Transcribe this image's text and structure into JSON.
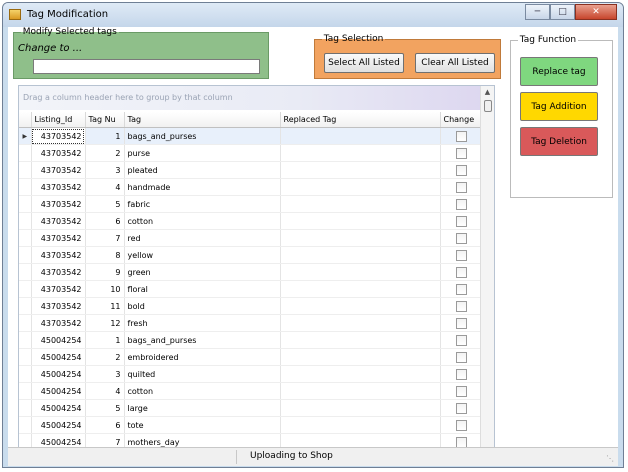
{
  "window": {
    "title": "Tag Modification",
    "minimize_icon": "minimize-icon",
    "maximize_icon": "maximize-icon",
    "close_icon": "close-icon"
  },
  "modify_group": {
    "legend": "Modify Selected tags",
    "change_label": "Change to ...",
    "change_value": ""
  },
  "tag_selection": {
    "legend": "Tag Selection",
    "select_all": "Select All Listed",
    "clear_all": "Clear All Listed"
  },
  "tag_function": {
    "legend": "Tag Function",
    "replace": "Replace tag",
    "addition": "Tag Addition",
    "deletion": "Tag Deletion",
    "colors": {
      "replace": "#7fd77f",
      "addition": "#ffd800",
      "deletion": "#d9595a"
    }
  },
  "grid": {
    "group_hint": "Drag a column header here to group by that column",
    "columns": [
      "Listing_Id",
      "Tag Nu",
      "Tag",
      "Replaced Tag",
      "Change"
    ],
    "rows": [
      {
        "id": "43703542",
        "num": "1",
        "tag": "bags_and_purses",
        "replaced": ""
      },
      {
        "id": "43703542",
        "num": "2",
        "tag": "purse",
        "replaced": ""
      },
      {
        "id": "43703542",
        "num": "3",
        "tag": "pleated",
        "replaced": ""
      },
      {
        "id": "43703542",
        "num": "4",
        "tag": "handmade",
        "replaced": ""
      },
      {
        "id": "43703542",
        "num": "5",
        "tag": "fabric",
        "replaced": ""
      },
      {
        "id": "43703542",
        "num": "6",
        "tag": "cotton",
        "replaced": ""
      },
      {
        "id": "43703542",
        "num": "7",
        "tag": "red",
        "replaced": ""
      },
      {
        "id": "43703542",
        "num": "8",
        "tag": "yellow",
        "replaced": ""
      },
      {
        "id": "43703542",
        "num": "9",
        "tag": "green",
        "replaced": ""
      },
      {
        "id": "43703542",
        "num": "10",
        "tag": "floral",
        "replaced": ""
      },
      {
        "id": "43703542",
        "num": "11",
        "tag": "bold",
        "replaced": ""
      },
      {
        "id": "43703542",
        "num": "12",
        "tag": "fresh",
        "replaced": ""
      },
      {
        "id": "45004254",
        "num": "1",
        "tag": "bags_and_purses",
        "replaced": ""
      },
      {
        "id": "45004254",
        "num": "2",
        "tag": "embroidered",
        "replaced": ""
      },
      {
        "id": "45004254",
        "num": "3",
        "tag": "quilted",
        "replaced": ""
      },
      {
        "id": "45004254",
        "num": "4",
        "tag": "cotton",
        "replaced": ""
      },
      {
        "id": "45004254",
        "num": "5",
        "tag": "large",
        "replaced": ""
      },
      {
        "id": "45004254",
        "num": "6",
        "tag": "tote",
        "replaced": ""
      },
      {
        "id": "45004254",
        "num": "7",
        "tag": "mothers_day",
        "replaced": ""
      }
    ]
  },
  "statusbar": {
    "text": "Uploading to Shop"
  }
}
